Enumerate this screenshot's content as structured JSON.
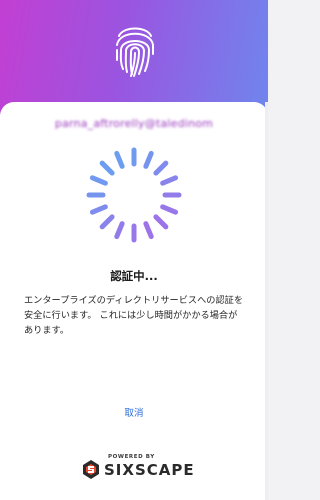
{
  "auth": {
    "email": "parna_aftrorelly@taledinom",
    "title": "認証中...",
    "message": "エンタープライズのディレクトリサービスへの認証を安全に行います。 これには少し時間がかかる場合があります。",
    "cancel_label": "取消"
  },
  "footer": {
    "powered_by": "POWERED BY",
    "brand": "SIXSCAPE"
  },
  "icons": {
    "fingerprint": "fingerprint-icon",
    "spinner": "loading-spinner-icon",
    "brand_logo": "sixscape-logo-icon"
  },
  "colors": {
    "gradient_start": "#c23fd3",
    "gradient_mid": "#9a55e0",
    "gradient_end": "#6f86ee",
    "spinner_blue": "#62a5f2",
    "spinner_purple": "#a66be6",
    "link": "#2d6ed8",
    "brand_red": "#e4452f"
  }
}
